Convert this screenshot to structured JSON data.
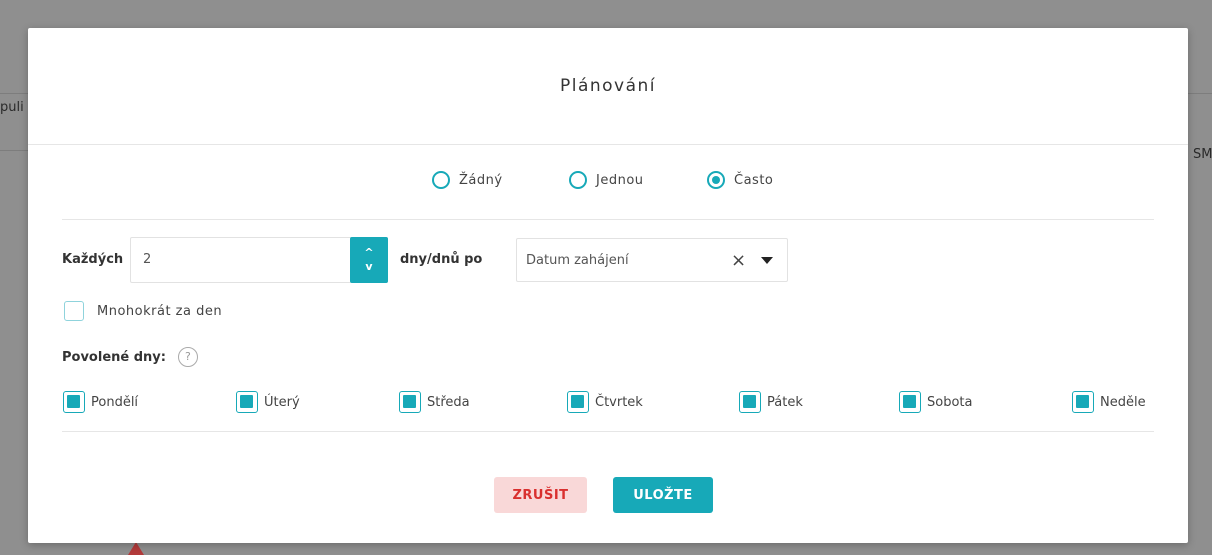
{
  "background": {
    "left_fragment": "puli",
    "right_fragment": "SM"
  },
  "modal": {
    "title": "Plánování",
    "frequency_options": [
      {
        "label": "Žádný",
        "checked": false
      },
      {
        "label": "Jednou",
        "checked": false
      },
      {
        "label": "Často",
        "checked": true
      }
    ],
    "every_label": "Každých",
    "every_value": "2",
    "stepper_up": "^",
    "stepper_down": "v",
    "days_after_label": "dny/dnů po",
    "date_select": {
      "value": "Datum zahájení",
      "clear_icon": "×"
    },
    "multiple_per_day": {
      "label": "Mnohokrát za den",
      "checked": false
    },
    "allowed_days_label": "Povolené dny:",
    "help_icon": "?",
    "days": [
      {
        "label": "Pondělí",
        "checked": true
      },
      {
        "label": "Úterý",
        "checked": true
      },
      {
        "label": "Středa",
        "checked": true
      },
      {
        "label": "Čtvrtek",
        "checked": true
      },
      {
        "label": "Pátek",
        "checked": true
      },
      {
        "label": "Sobota",
        "checked": true
      },
      {
        "label": "Neděle",
        "checked": true
      }
    ],
    "cancel_label": "ZRUŠIT",
    "save_label": "ULOŽTE"
  },
  "colors": {
    "accent": "#17a9b8",
    "cancel_bg": "#f9d8d8",
    "cancel_text": "#d9302f",
    "overlay": "#8e8e8e"
  }
}
